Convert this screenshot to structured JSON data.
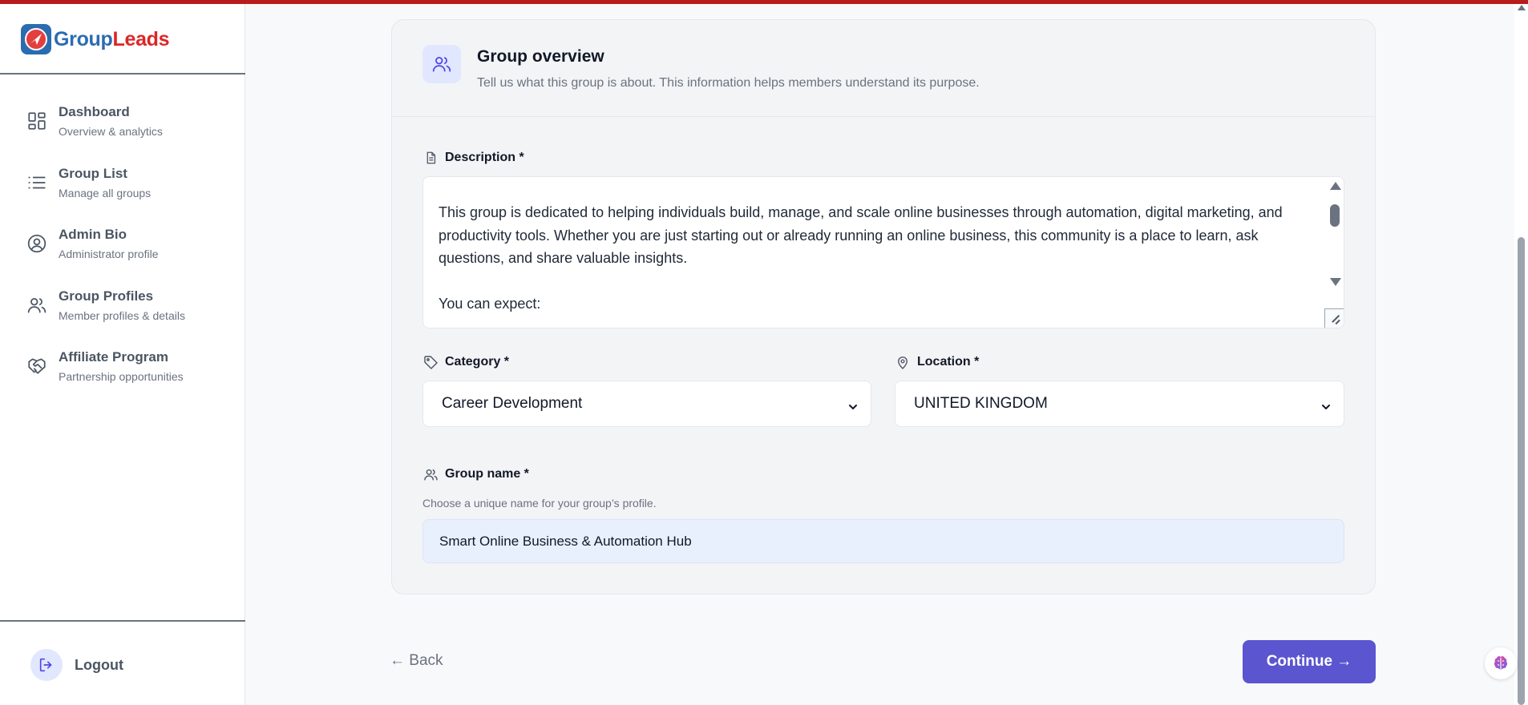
{
  "brand": {
    "part1": "Group",
    "part2": "Leads"
  },
  "sidebar": {
    "items": [
      {
        "label": "Dashboard",
        "sub": "Overview & analytics",
        "icon": "dashboard-grid-icon"
      },
      {
        "label": "Group List",
        "sub": "Manage all groups",
        "icon": "list-icon"
      },
      {
        "label": "Admin Bio",
        "sub": "Administrator profile",
        "icon": "user-circle-icon"
      },
      {
        "label": "Group Profiles",
        "sub": "Member profiles & details",
        "icon": "users-icon"
      },
      {
        "label": "Affiliate Program",
        "sub": "Partnership opportunities",
        "icon": "handshake-icon"
      }
    ],
    "logout_label": "Logout"
  },
  "overview": {
    "title": "Group overview",
    "subtitle": "Tell us what this group is about. This information helps members understand its purpose."
  },
  "description": {
    "label": "Description *",
    "value": "This group is dedicated to helping individuals build, manage, and scale online businesses through automation, digital marketing, and productivity tools. Whether you are just starting out or already running an online business, this community is a place to learn, ask questions, and share valuable insights.\n\nYou can expect:"
  },
  "category": {
    "label": "Category *",
    "value": "Career Development"
  },
  "location": {
    "label": "Location *",
    "value": "UNITED KINGDOM"
  },
  "group_name": {
    "label": "Group name *",
    "help": "Choose a unique name for your group’s profile.",
    "value": "Smart Online Business & Automation Hub"
  },
  "actions": {
    "back_label": "← Back",
    "continue_label": "Continue →"
  },
  "colors": {
    "accent": "#5b55d0",
    "brand_blue": "#2b6cb0",
    "brand_red": "#dc2626",
    "top_bar": "#b91c1c"
  }
}
